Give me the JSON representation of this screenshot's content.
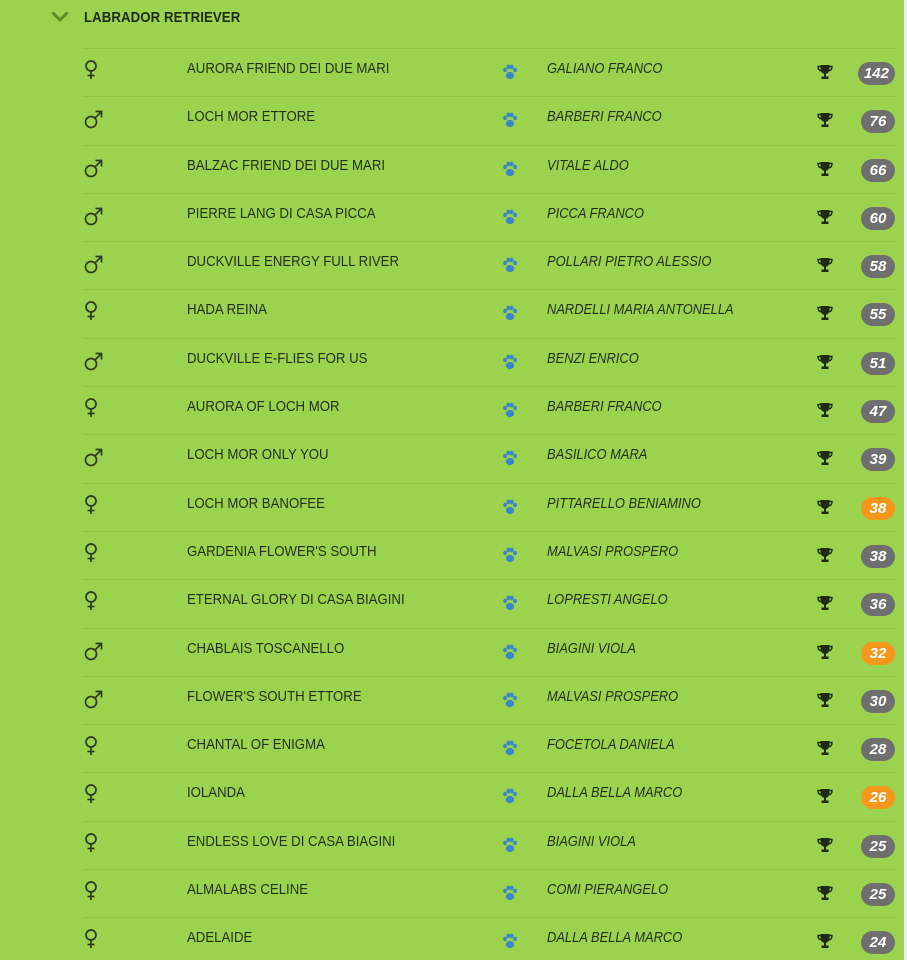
{
  "section": {
    "title": "LABRADOR RETRIEVER",
    "icon": "chevron-down-icon"
  },
  "colors": {
    "background": "#9bd34f",
    "paw": "#3a86c8",
    "badge_default": "#6f6f6f",
    "badge_highlight": "#f5961d"
  },
  "rows": [
    {
      "sex": "female",
      "dog": "AURORA FRIEND DEI DUE MARI",
      "owner": "GALIANO FRANCO",
      "score": "142",
      "highlight": false
    },
    {
      "sex": "male",
      "dog": "LOCH MOR ETTORE",
      "owner": "BARBERI FRANCO",
      "score": "76",
      "highlight": false
    },
    {
      "sex": "male",
      "dog": "BALZAC FRIEND DEI DUE MARI",
      "owner": "VITALE ALDO",
      "score": "66",
      "highlight": false
    },
    {
      "sex": "male",
      "dog": "PIERRE LANG DI CASA PICCA",
      "owner": "PICCA FRANCO",
      "score": "60",
      "highlight": false
    },
    {
      "sex": "male",
      "dog": "DUCKVILLE ENERGY FULL RIVER",
      "owner": "POLLARI PIETRO ALESSIO",
      "score": "58",
      "highlight": false
    },
    {
      "sex": "female",
      "dog": "HADA REINA",
      "owner": "NARDELLI MARIA ANTONELLA",
      "score": "55",
      "highlight": false
    },
    {
      "sex": "male",
      "dog": "DUCKVILLE E-FLIES FOR US",
      "owner": "BENZI ENRICO",
      "score": "51",
      "highlight": false
    },
    {
      "sex": "female",
      "dog": "AURORA OF LOCH MOR",
      "owner": "BARBERI FRANCO",
      "score": "47",
      "highlight": false
    },
    {
      "sex": "male",
      "dog": "LOCH MOR ONLY YOU",
      "owner": "BASILICO MARA",
      "score": "39",
      "highlight": false
    },
    {
      "sex": "female",
      "dog": "LOCH MOR BANOFEE",
      "owner": "PITTARELLO BENIAMINO",
      "score": "38",
      "highlight": true
    },
    {
      "sex": "female",
      "dog": "GARDENIA FLOWER'S SOUTH",
      "owner": "MALVASI PROSPERO",
      "score": "38",
      "highlight": false
    },
    {
      "sex": "female",
      "dog": "ETERNAL GLORY DI CASA BIAGINI",
      "owner": "LOPRESTI ANGELO",
      "score": "36",
      "highlight": false
    },
    {
      "sex": "male",
      "dog": "CHABLAIS TOSCANELLO",
      "owner": "BIAGINI VIOLA",
      "score": "32",
      "highlight": true
    },
    {
      "sex": "male",
      "dog": "FLOWER'S SOUTH ETTORE",
      "owner": "MALVASI PROSPERO",
      "score": "30",
      "highlight": false
    },
    {
      "sex": "female",
      "dog": "CHANTAL OF ENIGMA",
      "owner": "FOCETOLA DANIELA",
      "score": "28",
      "highlight": false
    },
    {
      "sex": "female",
      "dog": "IOLANDA",
      "owner": "DALLA BELLA MARCO",
      "score": "26",
      "highlight": true
    },
    {
      "sex": "female",
      "dog": "ENDLESS LOVE DI CASA BIAGINI",
      "owner": "BIAGINI VIOLA",
      "score": "25",
      "highlight": false
    },
    {
      "sex": "female",
      "dog": "ALMALABS CELINE",
      "owner": "COMI PIERANGELO",
      "score": "25",
      "highlight": false
    },
    {
      "sex": "female",
      "dog": "ADELAIDE",
      "owner": "DALLA BELLA MARCO",
      "score": "24",
      "highlight": false
    }
  ]
}
